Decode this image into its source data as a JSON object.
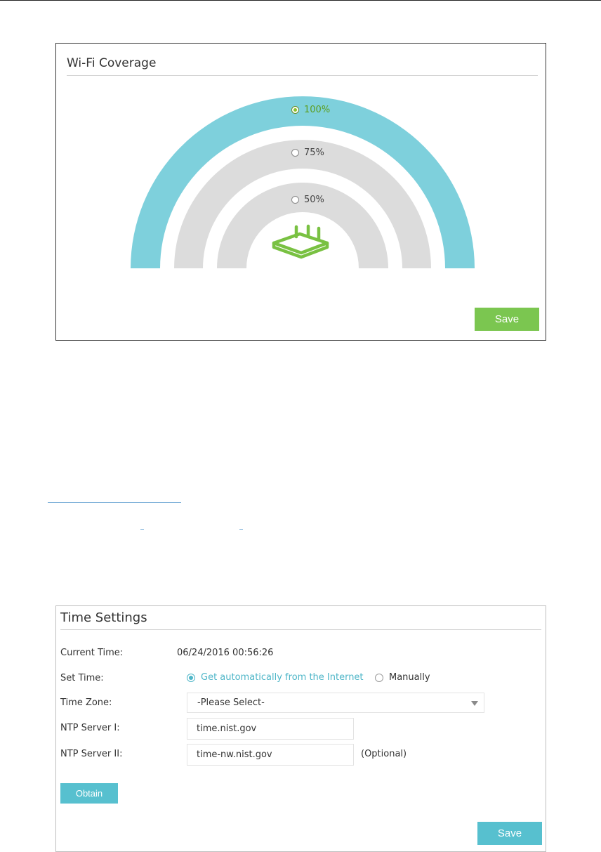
{
  "wifi_coverage": {
    "title": "Wi-Fi Coverage",
    "options": [
      {
        "label": "100%",
        "selected": true
      },
      {
        "label": "75%",
        "selected": false
      },
      {
        "label": "50%",
        "selected": false
      }
    ],
    "save_label": "Save",
    "colors": {
      "selected_band": "#7ed0dc",
      "band": "#dcdcdc",
      "router": "#79c142",
      "save_button": "#7bc650",
      "selected_text": "#5c9d1e"
    },
    "router_icon": "router-icon"
  },
  "time_settings": {
    "title": "Time Settings",
    "current_time": {
      "label": "Current Time:",
      "value": "06/24/2016 00:56:26"
    },
    "set_time": {
      "label": "Set Time:",
      "options": [
        {
          "label": "Get automatically from the Internet",
          "selected": true
        },
        {
          "label": "Manually",
          "selected": false
        }
      ]
    },
    "time_zone": {
      "label": "Time Zone:",
      "value": "-Please Select-"
    },
    "ntp_server_1": {
      "label": "NTP Server I:",
      "value": "time.nist.gov"
    },
    "ntp_server_2": {
      "label": "NTP Server II:",
      "value": "time-nw.nist.gov",
      "hint": "(Optional)"
    },
    "obtain_label": "Obtain",
    "save_label": "Save",
    "colors": {
      "accent": "#57c0cf"
    }
  }
}
